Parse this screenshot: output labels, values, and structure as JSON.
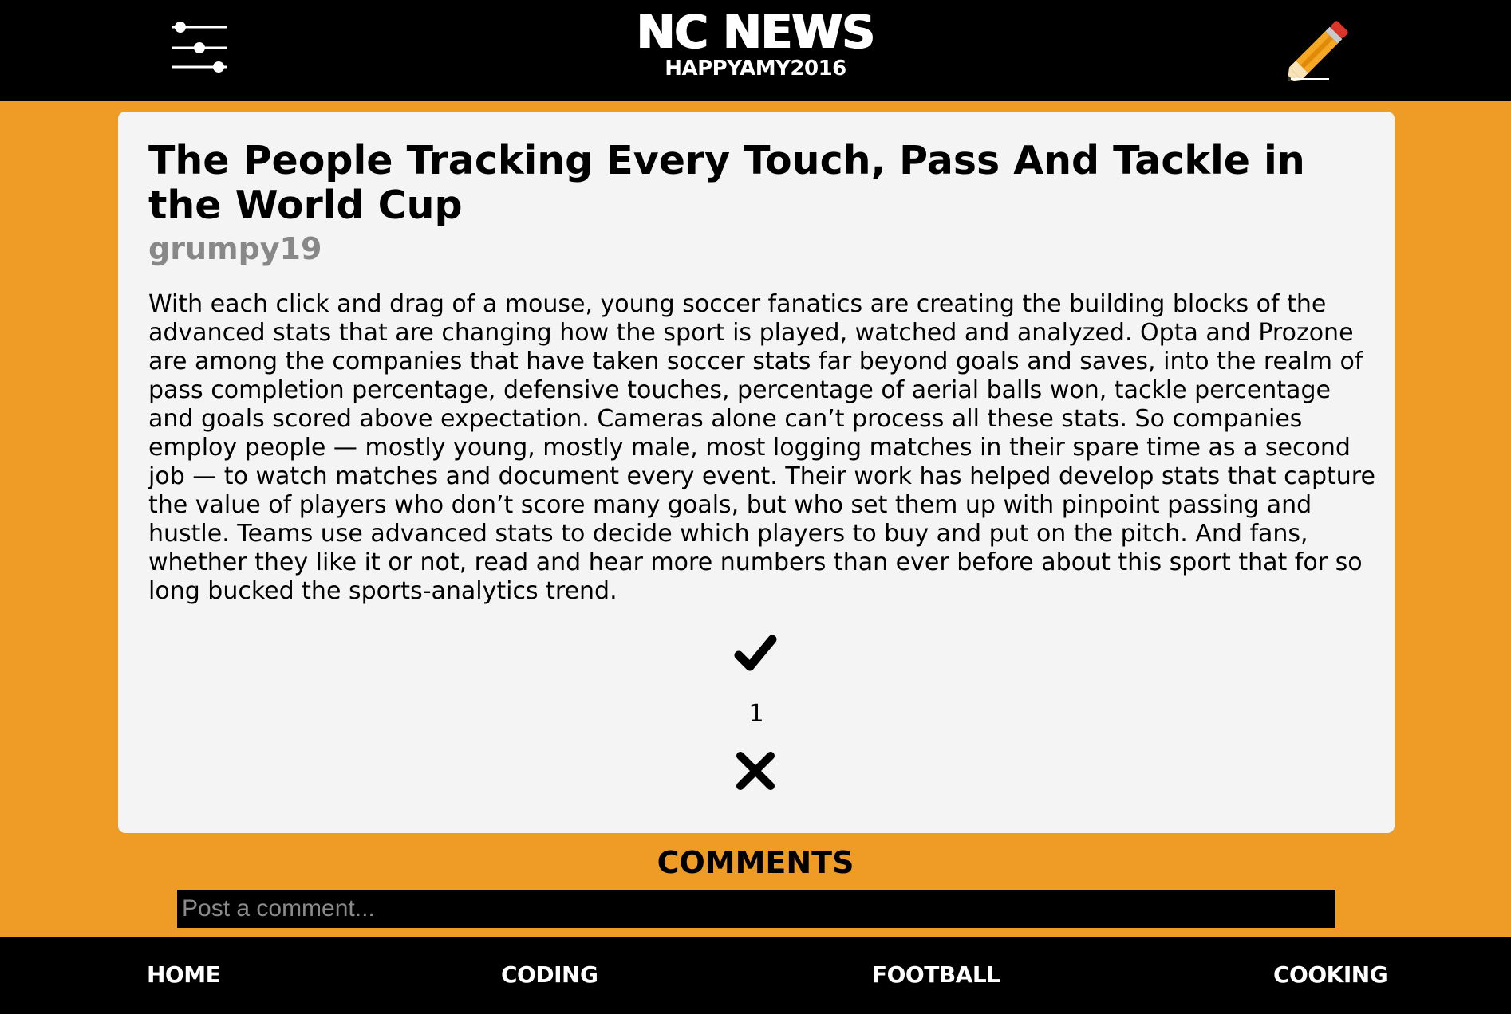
{
  "header": {
    "title": "NC NEWS",
    "username": "HAPPYAMY2016",
    "filter_icon": "sliders-icon",
    "compose_icon": "pencil-icon"
  },
  "article": {
    "title": "The People Tracking Every Touch, Pass And Tackle in the World Cup",
    "author": "grumpy19",
    "body": "With each click and drag of a mouse, young soccer fanatics are creating the building blocks of the advanced stats that are changing how the sport is played, watched and analyzed. Opta and Prozone are among the companies that have taken soccer stats far beyond goals and saves, into the realm of pass completion percentage, defensive touches, percentage of aerial balls won, tackle percentage and goals scored above expectation. Cameras alone can’t process all these stats. So companies employ people — mostly young, mostly male, most logging matches in their spare time as a second job — to watch matches and document every event. Their work has helped develop stats that capture the value of players who don’t score many goals, but who set them up with pinpoint passing and hustle. Teams use advanced stats to decide which players to buy and put on the pitch. And fans, whether they like it or not, read and hear more numbers than ever before about this sport that for so long bucked the sports-analytics trend.",
    "votes": "1",
    "upvote_icon": "checkmark-icon",
    "downvote_icon": "cross-icon"
  },
  "comments": {
    "heading": "COMMENTS",
    "placeholder": "Post a comment..."
  },
  "footer": {
    "nav": [
      "HOME",
      "CODING",
      "FOOTBALL",
      "COOKING"
    ]
  },
  "colors": {
    "background": "#ef9c26",
    "bars": "#000000",
    "card": "#f4f4f4",
    "author": "#888888"
  }
}
